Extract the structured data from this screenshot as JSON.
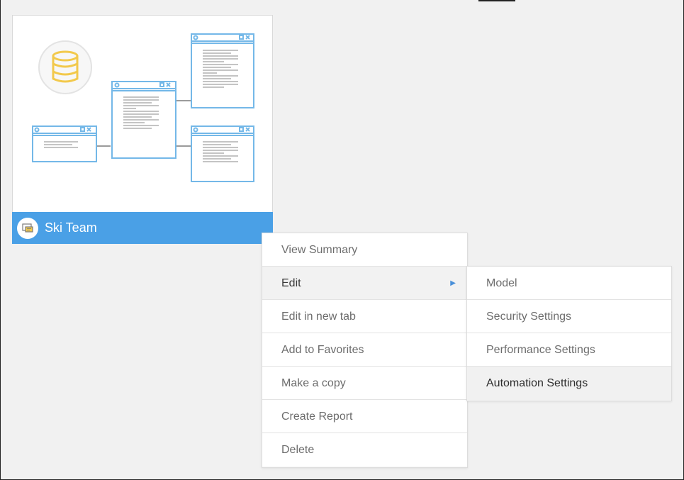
{
  "card": {
    "title": "Ski Team"
  },
  "menu": {
    "items": [
      {
        "label": "View Summary"
      },
      {
        "label": "Edit"
      },
      {
        "label": "Edit in new tab"
      },
      {
        "label": "Add to Favorites"
      },
      {
        "label": "Make a copy"
      },
      {
        "label": "Create Report"
      },
      {
        "label": "Delete"
      }
    ]
  },
  "submenu": {
    "items": [
      {
        "label": "Model"
      },
      {
        "label": "Security Settings"
      },
      {
        "label": "Performance Settings"
      },
      {
        "label": "Automation Settings"
      }
    ]
  },
  "icons": {
    "database": "database-icon",
    "caret": "chevron-right-icon",
    "view": "view-icon"
  },
  "colors": {
    "accent": "#4aa0e6",
    "db_gold": "#f2c94c",
    "window_blue": "#74b8e8"
  }
}
